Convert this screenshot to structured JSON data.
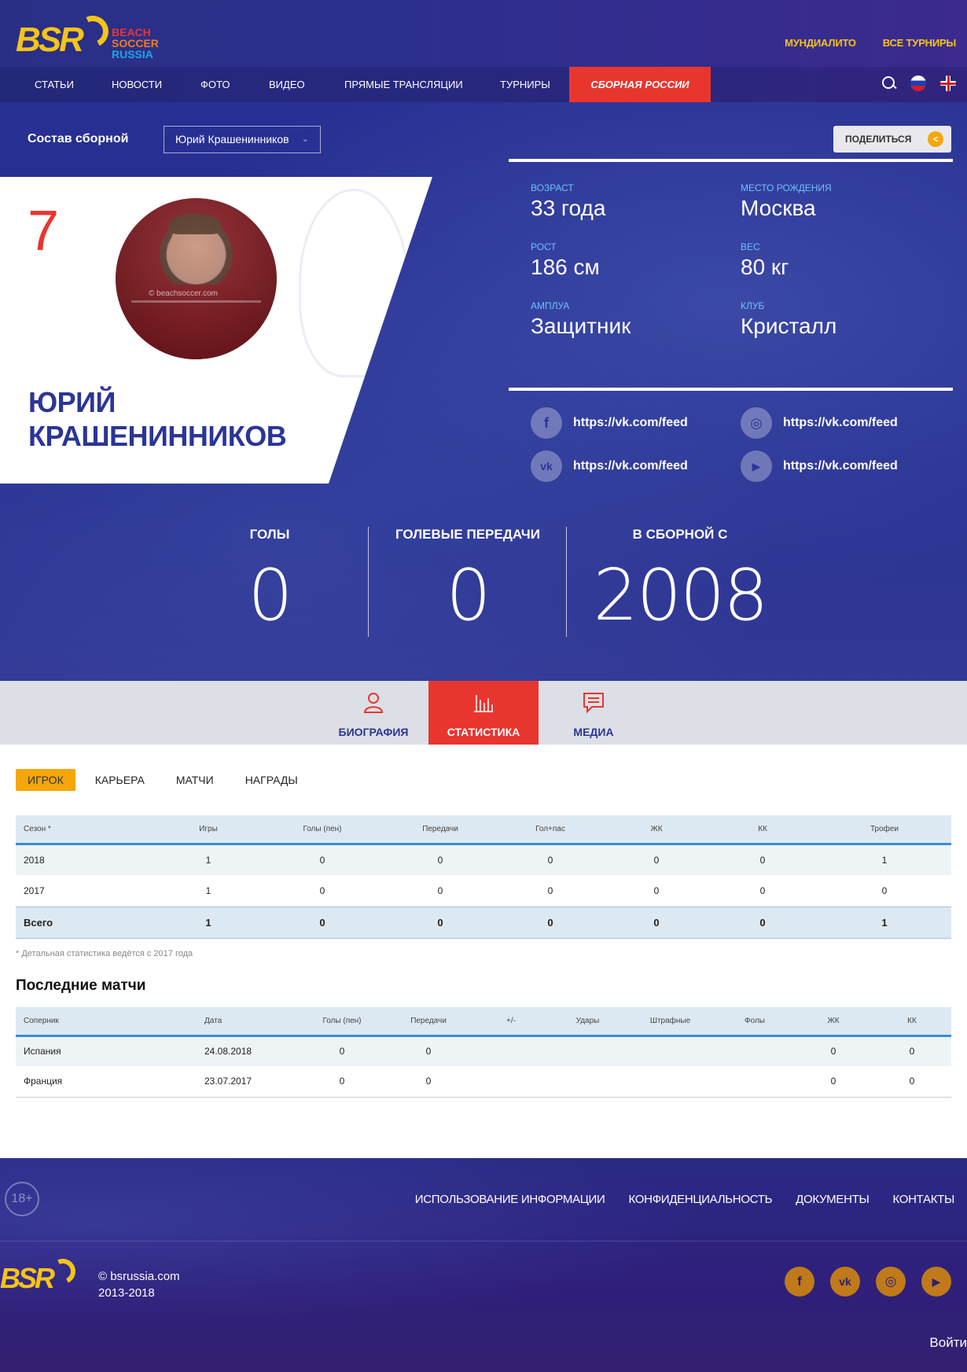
{
  "header": {
    "logo": {
      "mark": "BSR",
      "line1": "BEACH",
      "line2": "SOCCER",
      "line3": "RUSSIA"
    },
    "top_links": [
      "МУНДИАЛИТО",
      "ВСЕ ТУРНИРЫ"
    ],
    "nav": [
      "СТАТЬИ",
      "НОВОСТИ",
      "ФОТО",
      "ВИДЕО",
      "ПРЯМЫЕ ТРАНСЛЯЦИИ",
      "ТУРНИРЫ",
      "СБОРНАЯ РОССИИ"
    ],
    "active_nav": "СБОРНАЯ РОССИИ",
    "icons": [
      "search-icon",
      "flag-ru-icon",
      "flag-uk-icon"
    ]
  },
  "hero": {
    "squad_label": "Состав сборной",
    "squad_select_value": "Юрий Крашенинников",
    "share_label": "ПОДЕЛИТЬСЯ",
    "player": {
      "number": "7",
      "first_name": "ЮРИЙ",
      "last_name": "КРАШЕНИННИКОВ",
      "photo_caption": "© beachsoccer.com"
    },
    "info": [
      {
        "label": "ВОЗРАСТ",
        "value": "33 года"
      },
      {
        "label": "МЕСТО РОЖДЕНИЯ",
        "value": "Москва"
      },
      {
        "label": "РОСТ",
        "value": "186 см"
      },
      {
        "label": "ВЕС",
        "value": "80 кг"
      },
      {
        "label": "АМПЛУА",
        "value": "Защитник"
      },
      {
        "label": "КЛУБ",
        "value": "Кристалл"
      }
    ],
    "social": [
      {
        "icon": "facebook-icon",
        "glyph": "f",
        "url": "https://vk.com/feed"
      },
      {
        "icon": "instagram-icon",
        "glyph": "◎",
        "url": "https://vk.com/feed"
      },
      {
        "icon": "vk-icon",
        "glyph": "vk",
        "url": "https://vk.com/feed"
      },
      {
        "icon": "youtube-icon",
        "glyph": "▶",
        "url": "https://vk.com/feed"
      }
    ],
    "stats": [
      {
        "label": "ГОЛЫ",
        "value": "0"
      },
      {
        "label": "ГОЛЕВЫЕ ПЕРЕДАЧИ",
        "value": "0"
      },
      {
        "label": "В СБОРНОЙ С",
        "value": "2008"
      }
    ]
  },
  "tabs": [
    {
      "label": "БИОГРАФИЯ",
      "icon": "person-icon"
    },
    {
      "label": "СТАТИСТИКА",
      "icon": "bar-chart-icon"
    },
    {
      "label": "МЕДИА",
      "icon": "chat-icon"
    }
  ],
  "active_tab": "СТАТИСТИКА",
  "subtabs": [
    "ИГРОК",
    "КАРЬЕРА",
    "МАТЧИ",
    "НАГРАДЫ"
  ],
  "active_subtab": "ИГРОК",
  "season_table": {
    "columns": [
      "Сезон *",
      "Игры",
      "Голы (пен)",
      "Передачи",
      "Гол+пас",
      "ЖК",
      "КК",
      "Трофеи"
    ],
    "rows": [
      [
        "2018",
        "1",
        "0",
        "0",
        "0",
        "0",
        "0",
        "1"
      ],
      [
        "2017",
        "1",
        "0",
        "0",
        "0",
        "0",
        "0",
        "0"
      ]
    ],
    "total": [
      "Всего",
      "1",
      "0",
      "0",
      "0",
      "0",
      "0",
      "1"
    ]
  },
  "note": "* Детальная статистика ведётся с 2017 года",
  "matches_title": "Последние матчи",
  "matches_table": {
    "columns": [
      "Соперник",
      "Дата",
      "Голы (пен)",
      "Передачи",
      "+/-",
      "Удары",
      "Штрафные",
      "Фолы",
      "ЖК",
      "КК"
    ],
    "rows": [
      [
        "Испания",
        "24.08.2018",
        "0",
        "0",
        "",
        "",
        "",
        "",
        "0",
        "0"
      ],
      [
        "Франция",
        "23.07.2017",
        "0",
        "0",
        "",
        "",
        "",
        "",
        "0",
        "0"
      ]
    ]
  },
  "footer": {
    "age": "18+",
    "links": [
      "ИСПОЛЬЗОВАНИЕ ИНФОРМАЦИИ",
      "КОНФИДЕНЦИАЛЬНОСТЬ",
      "ДОКУМЕНТЫ",
      "КОНТАКТЫ"
    ],
    "logo": "BSR",
    "copyright_line1": "© bsrussia.com",
    "copyright_line2": "2013-2018",
    "social": [
      {
        "icon": "facebook-icon",
        "glyph": "f"
      },
      {
        "icon": "vk-icon",
        "glyph": "vk"
      },
      {
        "icon": "instagram-icon",
        "glyph": "◎"
      },
      {
        "icon": "youtube-icon",
        "glyph": "▶"
      }
    ],
    "login": "Войти"
  },
  "colors": {
    "brand_blue": "#2b3596",
    "accent_red": "#e8362f",
    "accent_yellow": "#f5c417",
    "accent_orange": "#f5a60a",
    "table_header": "#dde9f2"
  }
}
